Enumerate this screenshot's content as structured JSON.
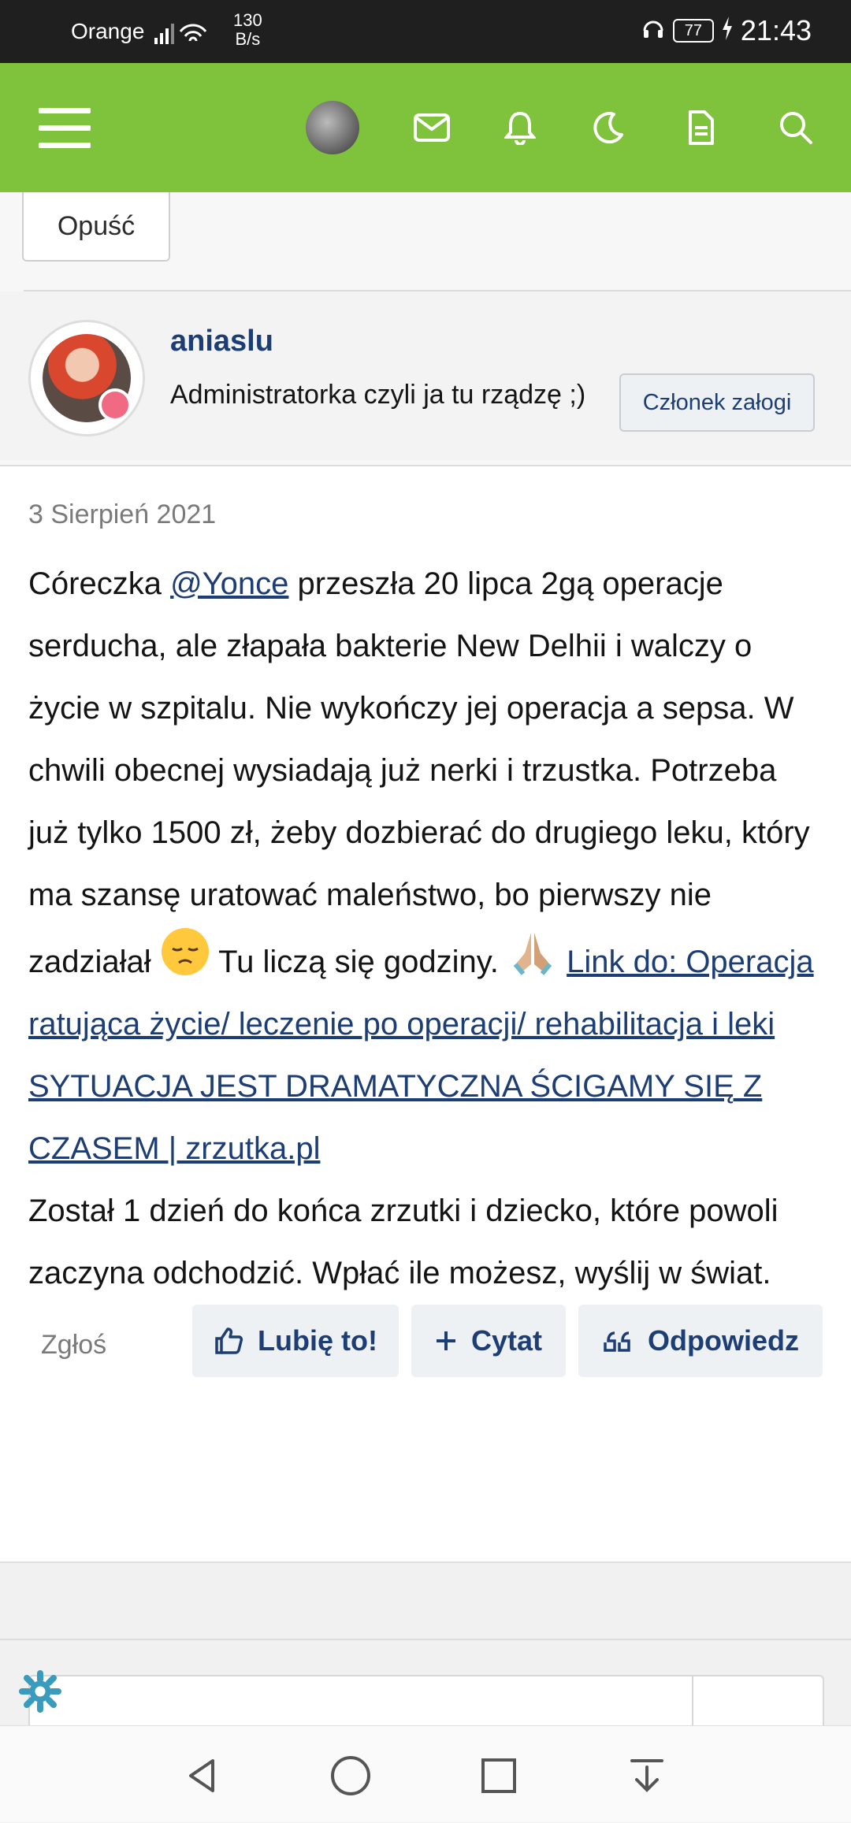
{
  "status_bar": {
    "carrier": "Orange",
    "net_speed": "130",
    "net_unit": "B/s",
    "battery": "77",
    "time": "21:43"
  },
  "header": {
    "icons": [
      "menu-icon",
      "avatar",
      "mail-icon",
      "bell-icon",
      "moon-icon",
      "document-icon",
      "search-icon"
    ],
    "color": "#7fc23b"
  },
  "leave_button": {
    "label": "Opuść"
  },
  "user": {
    "name": "aniaslu",
    "title": "Administratorka czyli ja tu rządzę ;)",
    "badge": "Członek załogi"
  },
  "post": {
    "date": "3 Sierpień 2021",
    "text_before_mention": "Córeczka ",
    "mention": "@Yonce",
    "text_after_mention": " przeszła 20 lipca 2gą operacje serducha, ale złapała bakterie New Delhii i walczy o życie w szpitalu. Nie wykończy jej operacja a sepsa. W chwili obecnej wysiadają już nerki i trzustka. Potrzeba już tylko 1500 zł, żeby dozbierać do drugiego leku, który ma szansę uratować maleństwo, bo pierwszy nie zadziałał ",
    "text_mid": " Tu liczą się godziny. ",
    "link": "Link do: Operacja ratująca życie/ leczenie po operacji/ rehabilitacja i leki SYTUACJA JEST DRAMATYCZNA ŚCIGAMY SIĘ Z CZASEM | zrzutka.pl",
    "text_end": "Został 1 dzień do końca zrzutki i dziecko, które powoli zaczyna odchodzić. Wpłać ile możesz, wyślij w świat."
  },
  "actions": {
    "report": "Zgłoś",
    "like": "Lubię to!",
    "quote": "Cytat",
    "reply": "Odpowiedz"
  }
}
